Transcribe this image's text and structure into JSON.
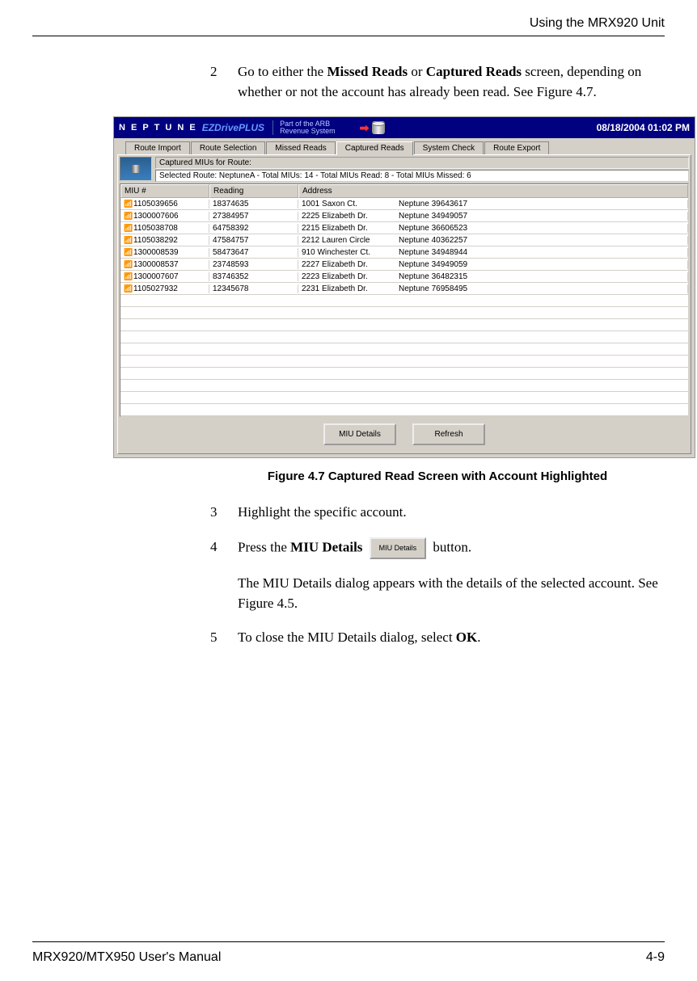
{
  "header": {
    "section_title": "Using the MRX920 Unit"
  },
  "steps": {
    "s2": {
      "num": "2",
      "pre": "Go to either the ",
      "bold1": "Missed Reads",
      "mid1": " or ",
      "bold2": "Captured Reads",
      "post": " screen, depending on whether or not the account has already been read. See Figure 4.7."
    },
    "s3": {
      "num": "3",
      "text": "Highlight the specific account."
    },
    "s4": {
      "num": "4",
      "pre": "Press the ",
      "bold": "MIU Details",
      "btn": "MIU Details",
      "post": " button."
    },
    "followup": "The MIU Details dialog appears with the details of the selected account. See Figure 4.5.",
    "s5": {
      "num": "5",
      "pre": "To close the MIU Details dialog, select ",
      "bold": "OK",
      "post": "."
    }
  },
  "figure": {
    "caption": "Figure 4.7   Captured Read Screen with Account Highlighted"
  },
  "app": {
    "brand": "N E P T U N E",
    "product": "EZDrivePLUS",
    "tagline1": "Part of the ARB",
    "tagline2": "Revenue System",
    "datetime": "08/18/2004 01:02 PM",
    "tabs": [
      "Route Import",
      "Route Selection",
      "Missed Reads",
      "Captured Reads",
      "System Check",
      "Route Export"
    ],
    "route_label": "Captured MIUs for Route:",
    "route_value": "Selected Route: NeptuneA - Total MIUs: 14 - Total MIUs Read: 8 - Total MIUs Missed: 6",
    "columns": {
      "miu": "MIU #",
      "reading": "Reading",
      "address": "Address"
    },
    "rows": [
      {
        "miu": "1105039656",
        "reading": "18374635",
        "addr1": "1001 Saxon Ct.",
        "addr2": "Neptune 39643617"
      },
      {
        "miu": "1300007606",
        "reading": "27384957",
        "addr1": "2225 Elizabeth Dr.",
        "addr2": "Neptune 34949057"
      },
      {
        "miu": "1105038708",
        "reading": "64758392",
        "addr1": "2215 Elizabeth Dr.",
        "addr2": "Neptune 36606523"
      },
      {
        "miu": "1105038292",
        "reading": "47584757",
        "addr1": "2212 Lauren Circle",
        "addr2": "Neptune 40362257"
      },
      {
        "miu": "1300008539",
        "reading": "58473647",
        "addr1": "910 Winchester Ct.",
        "addr2": "Neptune 34948944"
      },
      {
        "miu": "1300008537",
        "reading": "23748593",
        "addr1": "2227 Elizabeth Dr.",
        "addr2": "Neptune 34949059"
      },
      {
        "miu": "1300007607",
        "reading": "83746352",
        "addr1": "2223 Elizabeth Dr.",
        "addr2": "Neptune 36482315"
      },
      {
        "miu": "1105027932",
        "reading": "12345678",
        "addr1": "2231 Elizabeth Dr.",
        "addr2": "Neptune 76958495"
      }
    ],
    "buttons": {
      "details": "MIU Details",
      "refresh": "Refresh"
    }
  },
  "footer": {
    "left": "MRX920/MTX950 User's Manual",
    "right": "4-9"
  }
}
